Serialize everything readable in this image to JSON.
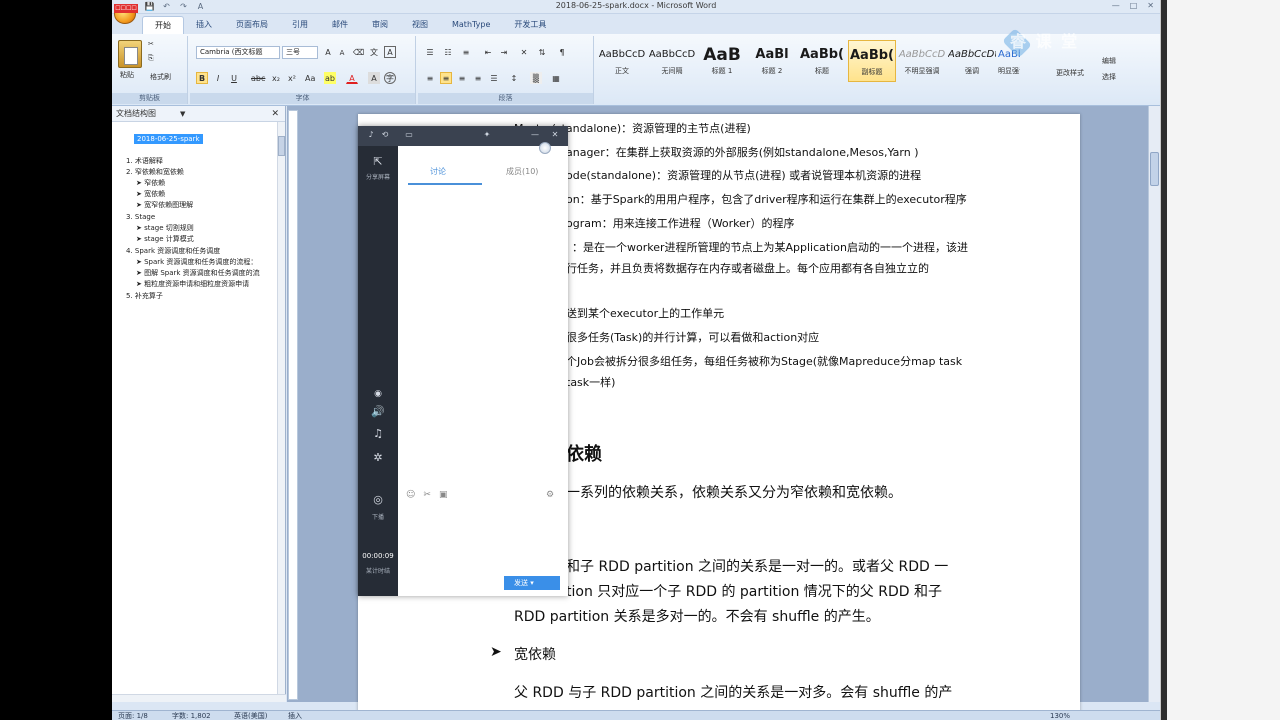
{
  "window": {
    "title": "2018-06-25-spark.docx - Microsoft Word",
    "office_badge": "☐☐☐☐",
    "qat": [
      "💾",
      "↶",
      "↷",
      "A"
    ],
    "controls": [
      "—",
      "□",
      "✕"
    ]
  },
  "tabs": [
    "开始",
    "插入",
    "页面布局",
    "引用",
    "邮件",
    "审阅",
    "视图",
    "MathType",
    "开发工具"
  ],
  "ribbon": {
    "clipboard": {
      "paste": "粘贴",
      "format_painter": "格式刷",
      "label": "剪贴板"
    },
    "font": {
      "name": "Cambria (西文标题",
      "size": "三号",
      "label": "字体",
      "bold": "B",
      "italic": "I",
      "underline": "U",
      "strike": "abc",
      "sub": "x₂",
      "sup": "x²",
      "aa": "Aa",
      "highlight": "ab",
      "color": "A",
      "grow": "A",
      "shrink": "A",
      "clear": "⌫",
      "phonetic": "文"
    },
    "paragraph": {
      "label": "段落"
    },
    "styles": [
      {
        "sample": "AaBbCcD",
        "name": "正文"
      },
      {
        "sample": "AaBbCcD",
        "name": "无间隔"
      },
      {
        "sample": "AaB",
        "name": "标题 1"
      },
      {
        "sample": "AaBl",
        "name": "标题 2"
      },
      {
        "sample": "AaBb(",
        "name": "标题"
      },
      {
        "sample": "AaBb(",
        "name": "副标题"
      },
      {
        "sample": "AaBbCcD",
        "name": "不明显强调"
      },
      {
        "sample": "AaBbCcDt",
        "name": "强调"
      },
      {
        "sample": "AaBbCcDt",
        "name": "明显强调"
      }
    ],
    "change_styles": "更改样式",
    "edit": "编辑",
    "select": "选择"
  },
  "watermark": "睿 课 堂",
  "docmap": {
    "title": "文档结构图",
    "close": "✕",
    "items": [
      {
        "text": "2018-06-25-spark",
        "sel": true
      },
      {
        "text": "1.  术语解释"
      },
      {
        "text": "2.  窄依赖和宽依赖"
      },
      {
        "text": "➤ 窄依赖"
      },
      {
        "text": "➤ 宽依赖"
      },
      {
        "text": "➤ 宽窄依赖图理解"
      },
      {
        "text": "3.  Stage"
      },
      {
        "text": "➤ stage 切割规则"
      },
      {
        "text": "➤ stage 计算模式"
      },
      {
        "text": "4.  Spark 资源调度和任务调度"
      },
      {
        "text": "➤ Spark 资源调度和任务调度的流程："
      },
      {
        "text": "➤ 图解 Spark 资源调度和任务调度的流"
      },
      {
        "text": "➤ 粗粒度资源申请和细粒度资源申请"
      },
      {
        "text": "5.  补充算子"
      }
    ]
  },
  "page": {
    "lines": [
      "Master(standalone)：资源管理的主节点(进程)",
      "anager：在集群上获取资源的外部服务(例如standalone,Mesos,Yarn )",
      "ode(standalone)：资源管理的从节点(进程) 或者说管理本机资源的进程",
      "on：基于Spark的用用户程序，包含了driver程序和运行在集群上的executor程序",
      "ogram：用来连接工作进程（Worker）的程序",
      "：是在一个worker进程所管理的节点上为某Application启动的一一个进程，该进",
      "行任务，并且负责将数据存在内存或者磁盘上。每个应用都有各自独立立的",
      "送到某个executor上的工作单元",
      "很多任务(Task)的并行计算，可以看做和action对应",
      "个Job会被拆分很多组任务，每组任务被称为Stage(就像Mapreduce分map task",
      "task一样)"
    ],
    "heading": "依赖",
    "para1": "一系列的依赖关系，依赖关系又分为窄依赖和宽依赖。",
    "para2a": "和子 RDD partition 之间的关系是一对一的。或者父 RDD 一",
    "para2b": "tion 只对应一个子 RDD 的 partition 情况下的父 RDD 和子",
    "para2c": "RDD partition 关系是多对一的。不会有 shuffle 的产生。",
    "bullet": "宽依赖",
    "para3": "父 RDD 与子 RDD partition 之间的关系是一对多。会有 shuffle 的产"
  },
  "overlay": {
    "tab1": "讨论",
    "tab2": "成员(10)",
    "side": {
      "share": "分享屏幕",
      "time": "00:00:09",
      "hint": "某计时结",
      "end": "下播"
    },
    "send": "发送"
  },
  "status": {
    "page": "页面: 1/8",
    "words": "字数: 1,802",
    "lang": "英语(美国)",
    "mode": "插入",
    "zoom": "130%"
  }
}
